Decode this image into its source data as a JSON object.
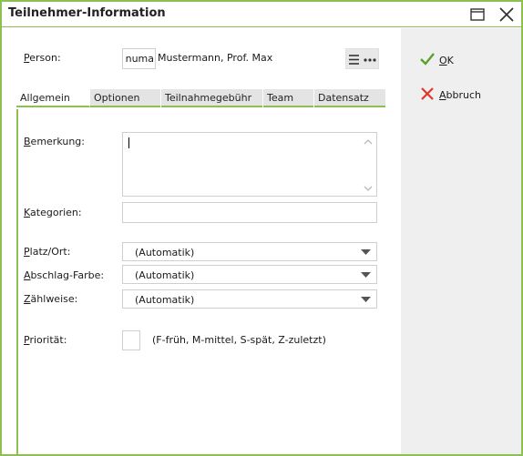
{
  "window": {
    "title": "Teilnehmer-Information"
  },
  "person": {
    "label_first": "P",
    "label_rest": "erson:",
    "code": "numa",
    "name": "Mustermann, Prof. Max"
  },
  "tabs": [
    {
      "label": "Allgemein",
      "active": true
    },
    {
      "label": "Optionen"
    },
    {
      "label": "Teilnahmegebühr"
    },
    {
      "label": "Team"
    },
    {
      "label": "Datensatz"
    }
  ],
  "fields": {
    "bemerkung": {
      "label_first": "B",
      "label_rest": "emerkung:",
      "value": ""
    },
    "kategorien": {
      "label_first": "K",
      "label_rest": "ategorien:",
      "value": ""
    },
    "platz": {
      "label_first": "P",
      "label_rest": "latz/Ort:",
      "value": "(Automatik)"
    },
    "abschlag": {
      "label_first": "A",
      "label_rest": "bschlag-Farbe:",
      "value": "(Automatik)"
    },
    "zaehlweise": {
      "label_first": "Z",
      "label_rest": "ählweise:",
      "value": "(Automatik)"
    },
    "prioritaet": {
      "label_first": "P",
      "label_rest": "riorität:",
      "value": "",
      "hint": "(F-früh, M-mittel, S-spät, Z-zuletzt)"
    }
  },
  "actions": {
    "ok_first": "O",
    "ok_rest": "K",
    "cancel_first": "A",
    "cancel_rest": "bbruch"
  },
  "colors": {
    "accent": "#8cc152",
    "ok_check": "#5aa02c",
    "cancel_x": "#e0352b",
    "side_panel": "#efefef"
  }
}
